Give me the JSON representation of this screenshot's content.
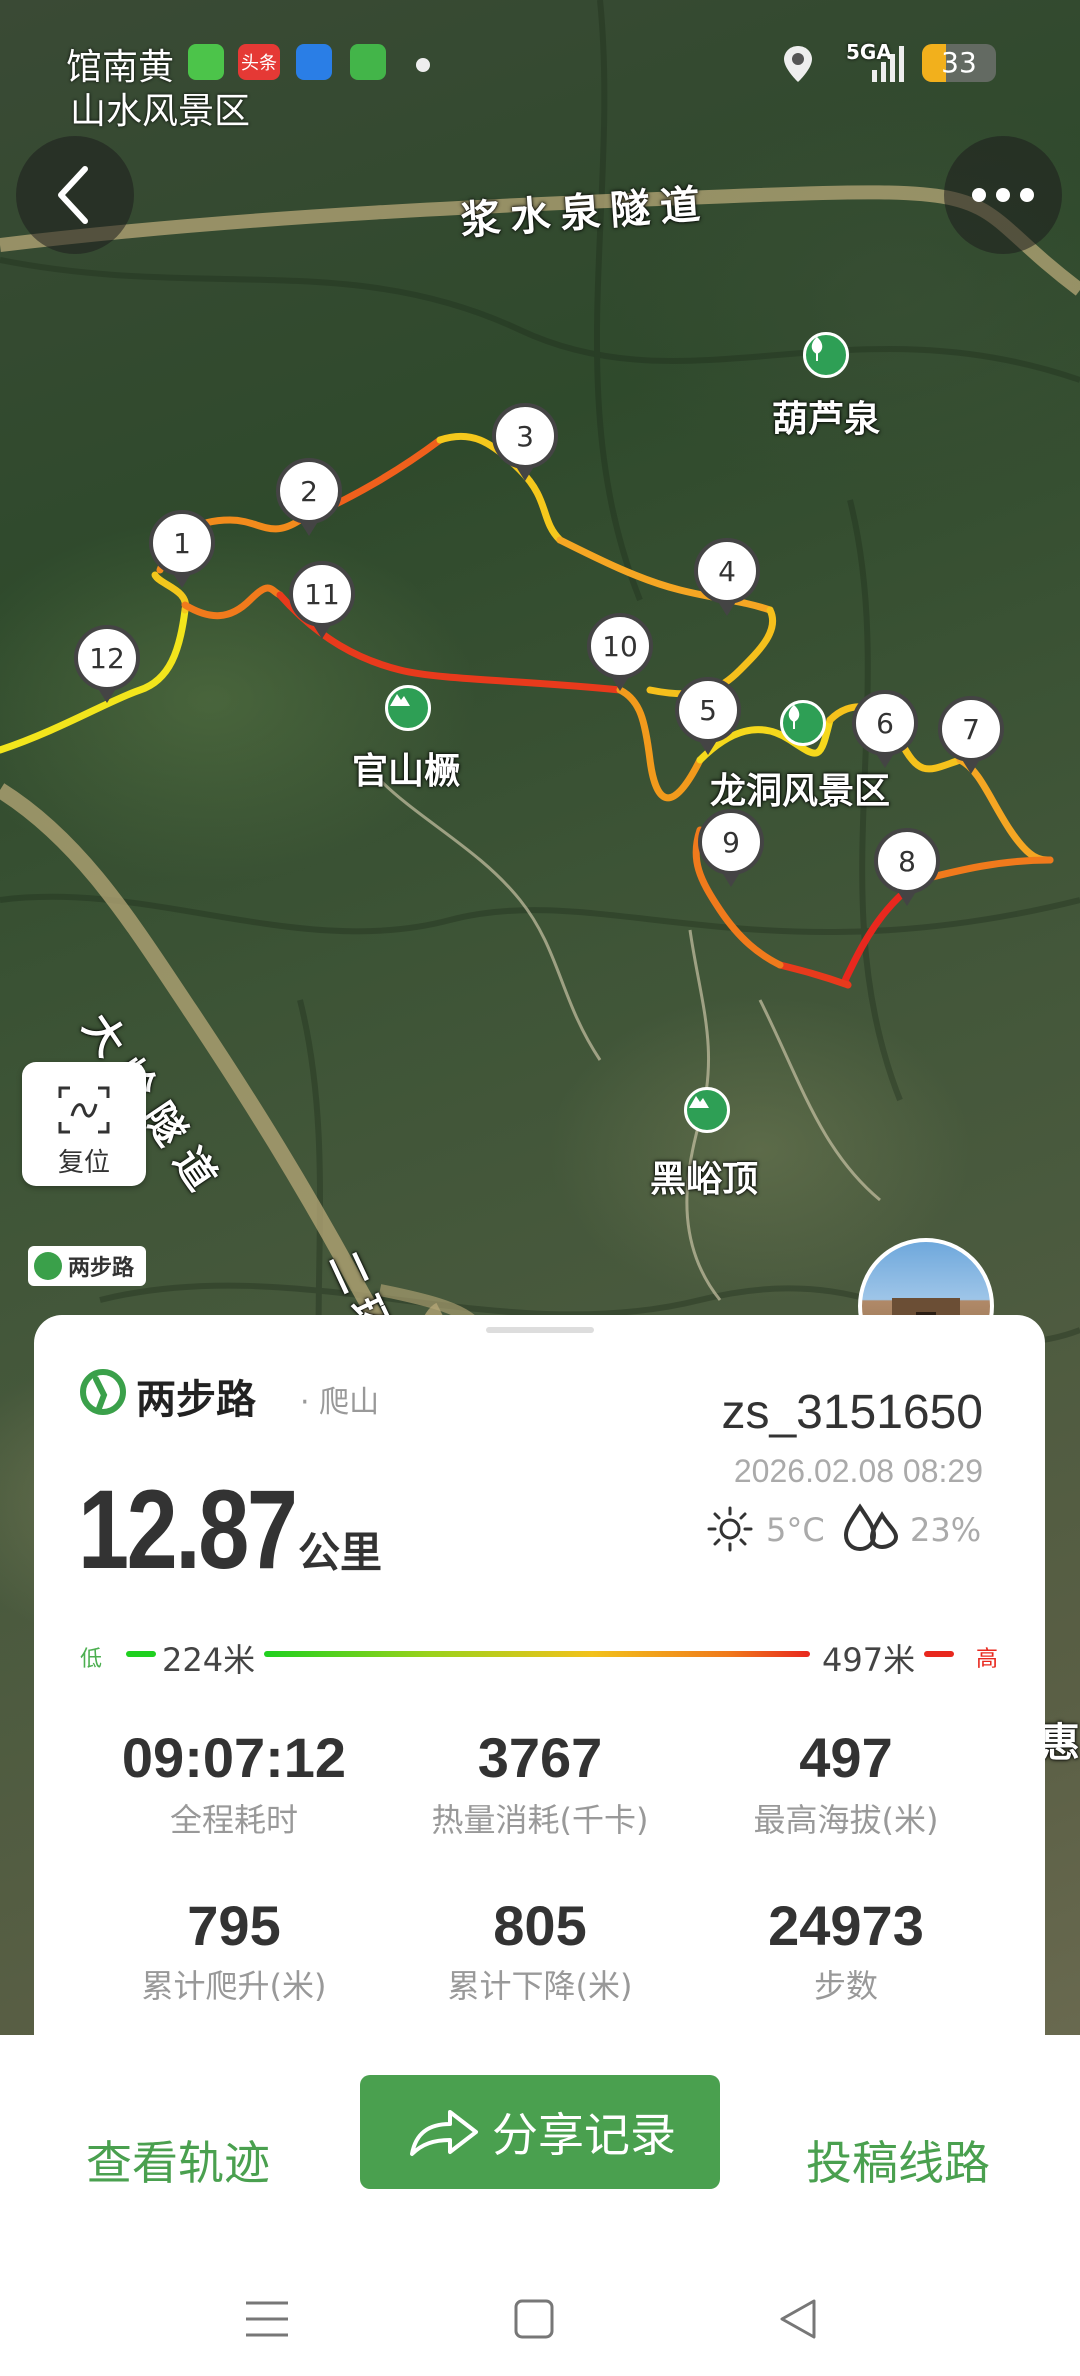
{
  "status_bar": {
    "left_text_line1": "馆南黄",
    "left_text_line2": "山水风景区",
    "network": "5GA",
    "battery": "33",
    "toutiao_badge": "头条"
  },
  "map": {
    "tunnel_top": "浆水泉隧道",
    "tunnel_left": "大岭隧道",
    "road_ring": "二环",
    "poi_hulu": "葫芦泉",
    "poi_guanshan": "官山橛",
    "poi_longdong": "龙洞风景区",
    "poi_heiyu": "黑峪顶",
    "reset_label": "复位",
    "brand_small": "两步路",
    "edge_char": "惠",
    "markers": [
      "1",
      "2",
      "3",
      "4",
      "5",
      "6",
      "7",
      "8",
      "9",
      "10",
      "11",
      "12"
    ]
  },
  "card": {
    "brand": "两步路",
    "activity": "· 爬山",
    "username": "zs_3151650",
    "datetime": "2026.02.08 08:29",
    "temperature": "5°C",
    "humidity": "23%",
    "distance_value": "12.87",
    "distance_unit": "公里",
    "elevation_low_label": "低",
    "elevation_low_value": "224米",
    "elevation_high_value": "497米",
    "elevation_high_label": "高",
    "stats": [
      {
        "value": "09:07:12",
        "label": "全程耗时"
      },
      {
        "value": "3767",
        "label": "热量消耗(千卡)"
      },
      {
        "value": "497",
        "label": "最高海拔(米)"
      },
      {
        "value": "795",
        "label": "累计爬升(米)"
      },
      {
        "value": "805",
        "label": "累计下降(米)"
      },
      {
        "value": "24973",
        "label": "步数"
      }
    ]
  },
  "actions": {
    "view_track": "查看轨迹",
    "share": "分享记录",
    "submit_route": "投稿线路"
  },
  "colors": {
    "brand_green": "#4aa04f",
    "track_low": "#f5e61a",
    "track_mid": "#f5a623",
    "track_high": "#e8281e"
  }
}
